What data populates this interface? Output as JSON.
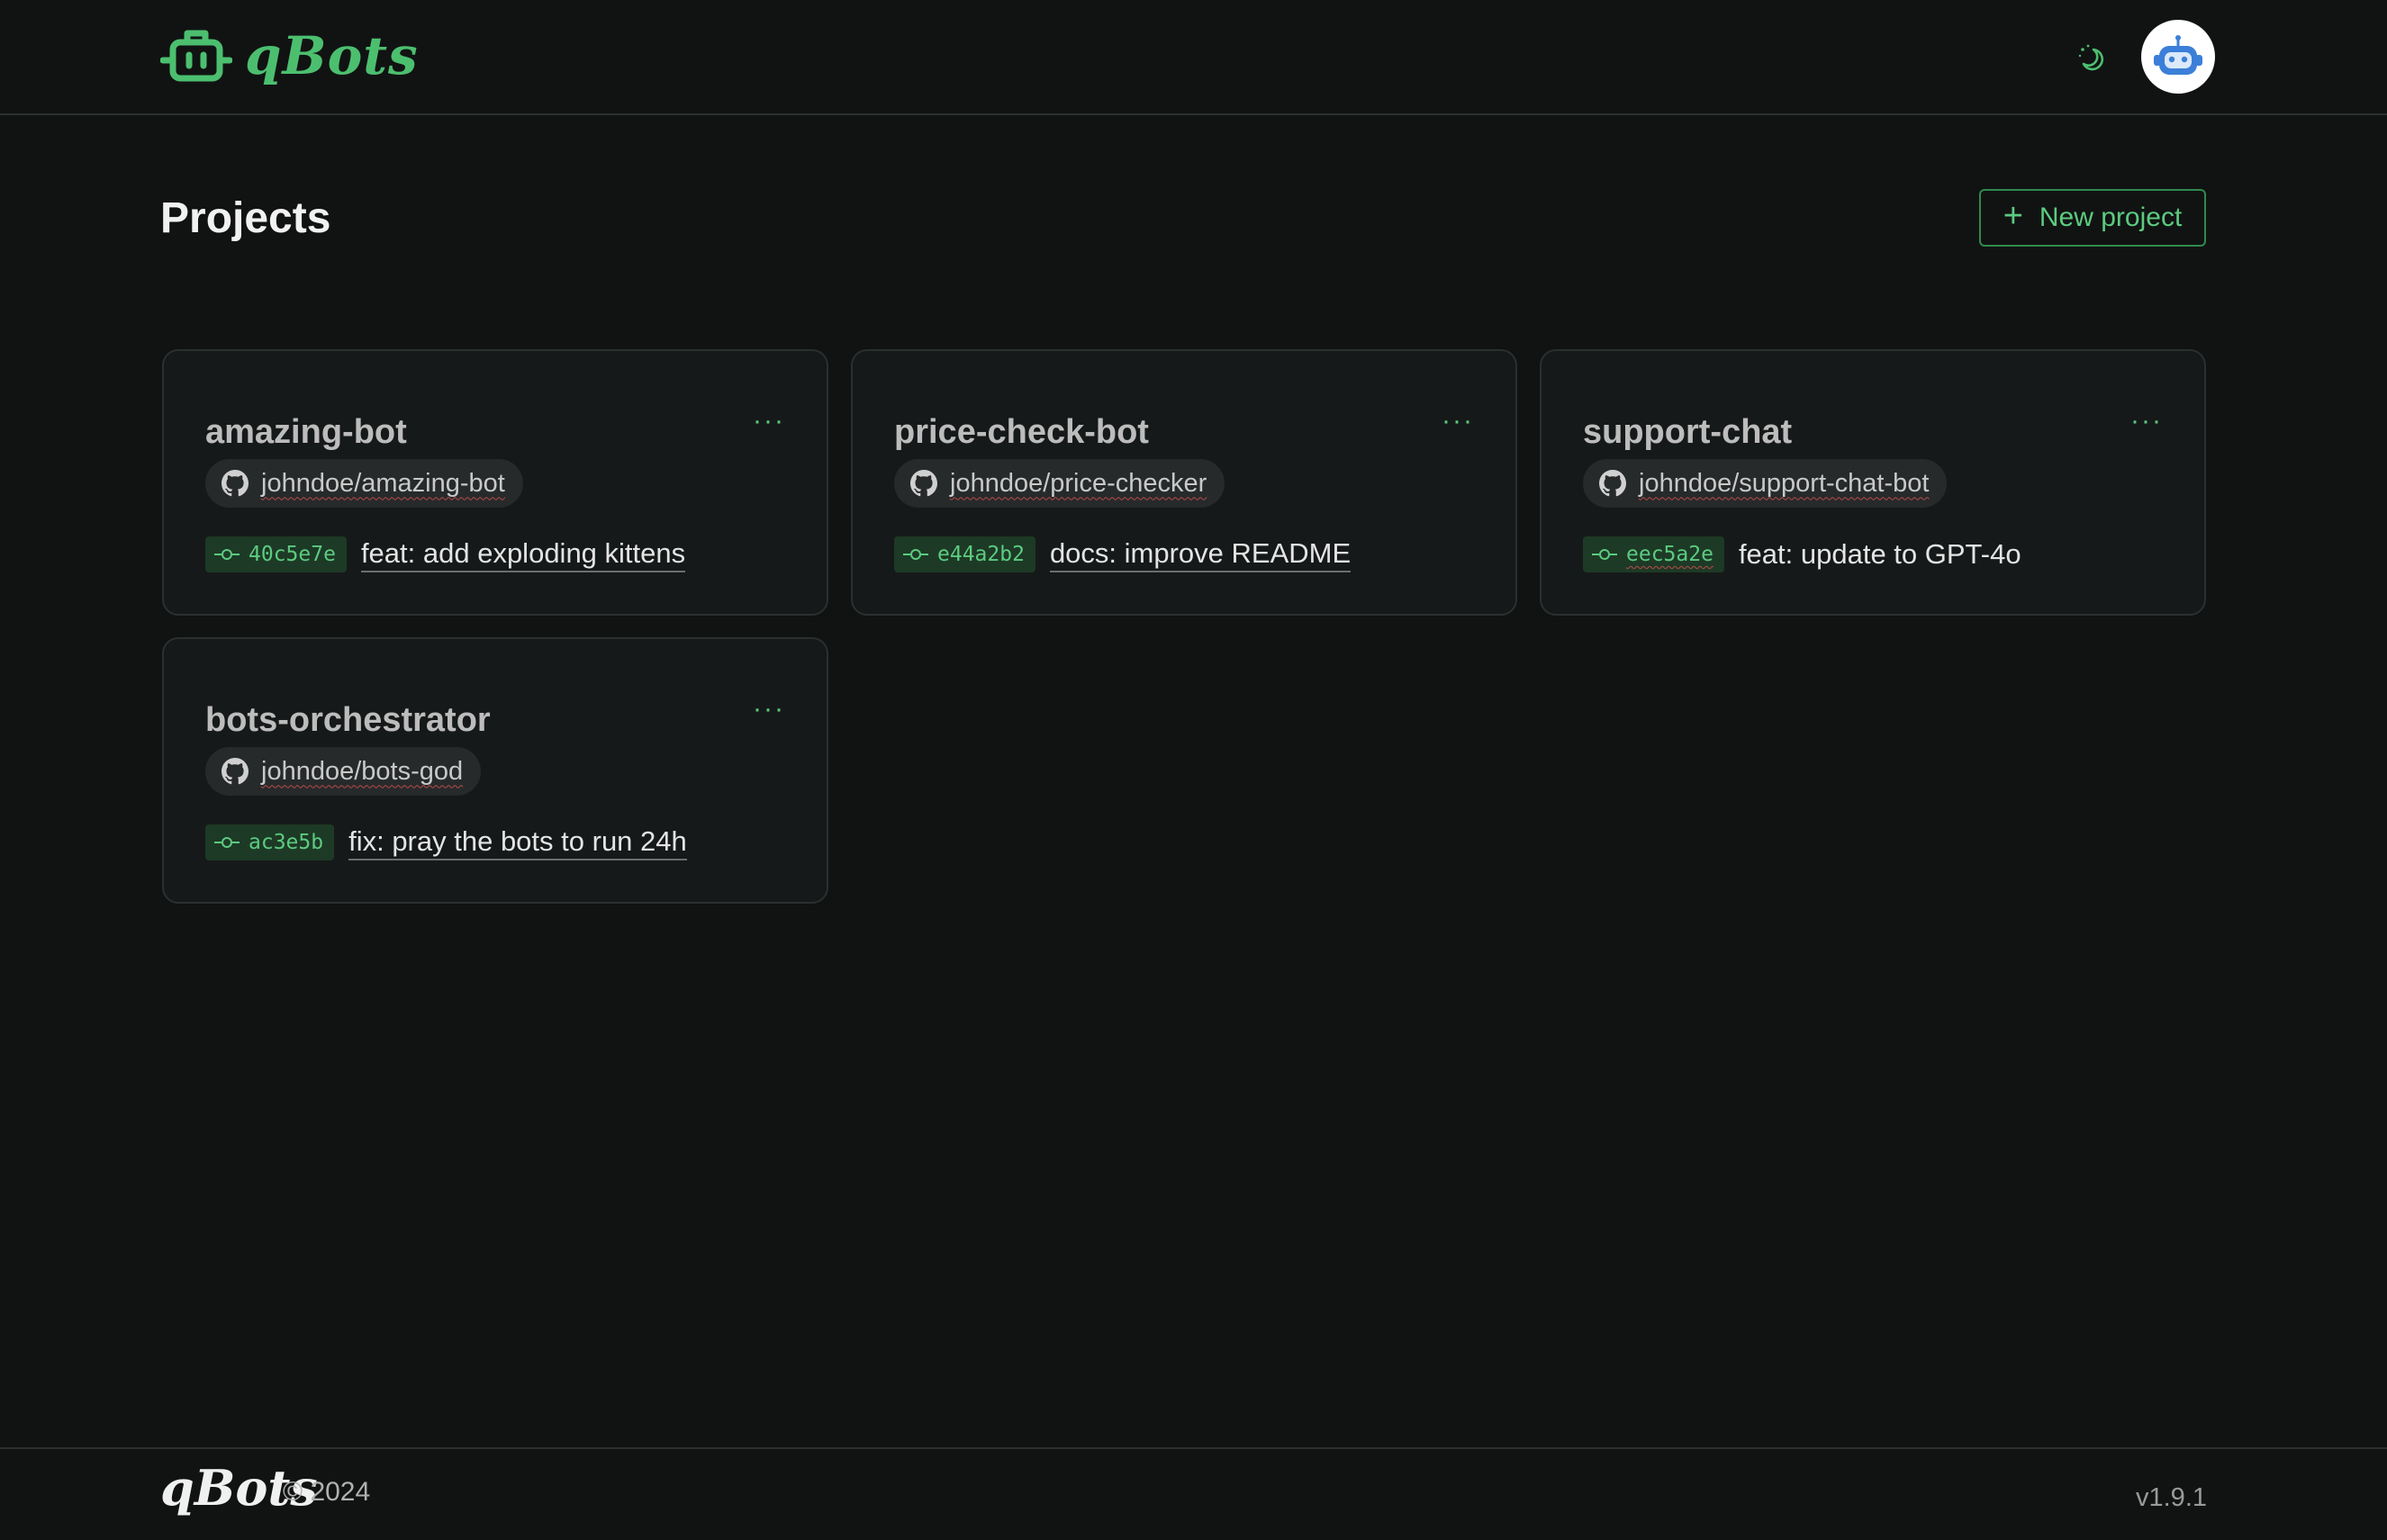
{
  "header": {
    "logo_text": "qBots",
    "theme_toggle_icon": "moon-stars-icon",
    "avatar_icon": "robot-face-icon"
  },
  "main": {
    "title": "Projects",
    "new_project_label": "New project"
  },
  "projects": [
    {
      "name": "amazing-bot",
      "repo": "johndoe/amazing-bot",
      "commit_hash": "40c5e7e",
      "commit_message": "feat: add exploding kittens"
    },
    {
      "name": "price-check-bot",
      "repo": "johndoe/price-checker",
      "commit_hash": "e44a2b2",
      "commit_message": "docs: improve README"
    },
    {
      "name": "support-chat",
      "repo": "johndoe/support-chat-bot",
      "commit_hash": "eec5a2e",
      "commit_message": "feat: update to GPT-4o"
    },
    {
      "name": "bots-orchestrator",
      "repo": "johndoe/bots-god",
      "commit_hash": "ac3e5b",
      "commit_message": "fix: pray the bots to run 24h"
    }
  ],
  "footer": {
    "logo_text": "qBots",
    "copyright": "© 2024",
    "version": "v1.9.1"
  },
  "colors": {
    "background": "#111313",
    "card": "#161919",
    "accent": "#5ccb80",
    "chip": "#272a2a",
    "hash_chip": "#1d3a26"
  }
}
